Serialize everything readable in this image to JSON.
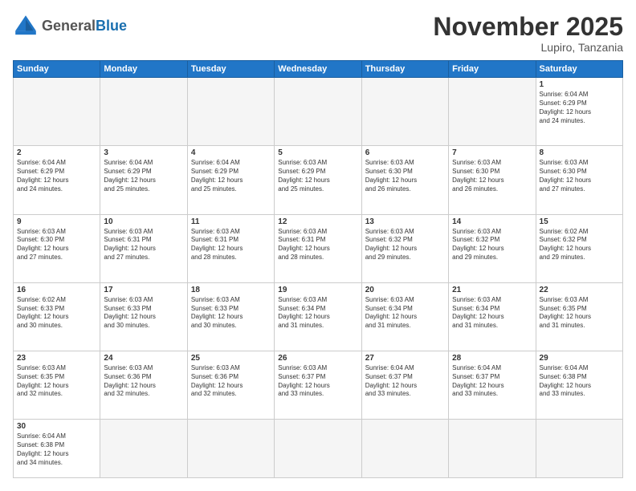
{
  "header": {
    "logo_general": "General",
    "logo_blue": "Blue",
    "month_title": "November 2025",
    "location": "Lupiro, Tanzania"
  },
  "weekdays": [
    "Sunday",
    "Monday",
    "Tuesday",
    "Wednesday",
    "Thursday",
    "Friday",
    "Saturday"
  ],
  "weeks": [
    [
      {
        "day": "",
        "info": "",
        "empty": true
      },
      {
        "day": "",
        "info": "",
        "empty": true
      },
      {
        "day": "",
        "info": "",
        "empty": true
      },
      {
        "day": "",
        "info": "",
        "empty": true
      },
      {
        "day": "",
        "info": "",
        "empty": true
      },
      {
        "day": "",
        "info": "",
        "empty": true
      },
      {
        "day": "1",
        "info": "Sunrise: 6:04 AM\nSunset: 6:29 PM\nDaylight: 12 hours\nand 24 minutes."
      }
    ],
    [
      {
        "day": "2",
        "info": "Sunrise: 6:04 AM\nSunset: 6:29 PM\nDaylight: 12 hours\nand 24 minutes."
      },
      {
        "day": "3",
        "info": "Sunrise: 6:04 AM\nSunset: 6:29 PM\nDaylight: 12 hours\nand 25 minutes."
      },
      {
        "day": "4",
        "info": "Sunrise: 6:04 AM\nSunset: 6:29 PM\nDaylight: 12 hours\nand 25 minutes."
      },
      {
        "day": "5",
        "info": "Sunrise: 6:03 AM\nSunset: 6:29 PM\nDaylight: 12 hours\nand 25 minutes."
      },
      {
        "day": "6",
        "info": "Sunrise: 6:03 AM\nSunset: 6:30 PM\nDaylight: 12 hours\nand 26 minutes."
      },
      {
        "day": "7",
        "info": "Sunrise: 6:03 AM\nSunset: 6:30 PM\nDaylight: 12 hours\nand 26 minutes."
      },
      {
        "day": "8",
        "info": "Sunrise: 6:03 AM\nSunset: 6:30 PM\nDaylight: 12 hours\nand 27 minutes."
      }
    ],
    [
      {
        "day": "9",
        "info": "Sunrise: 6:03 AM\nSunset: 6:30 PM\nDaylight: 12 hours\nand 27 minutes."
      },
      {
        "day": "10",
        "info": "Sunrise: 6:03 AM\nSunset: 6:31 PM\nDaylight: 12 hours\nand 27 minutes."
      },
      {
        "day": "11",
        "info": "Sunrise: 6:03 AM\nSunset: 6:31 PM\nDaylight: 12 hours\nand 28 minutes."
      },
      {
        "day": "12",
        "info": "Sunrise: 6:03 AM\nSunset: 6:31 PM\nDaylight: 12 hours\nand 28 minutes."
      },
      {
        "day": "13",
        "info": "Sunrise: 6:03 AM\nSunset: 6:32 PM\nDaylight: 12 hours\nand 29 minutes."
      },
      {
        "day": "14",
        "info": "Sunrise: 6:03 AM\nSunset: 6:32 PM\nDaylight: 12 hours\nand 29 minutes."
      },
      {
        "day": "15",
        "info": "Sunrise: 6:02 AM\nSunset: 6:32 PM\nDaylight: 12 hours\nand 29 minutes."
      }
    ],
    [
      {
        "day": "16",
        "info": "Sunrise: 6:02 AM\nSunset: 6:33 PM\nDaylight: 12 hours\nand 30 minutes."
      },
      {
        "day": "17",
        "info": "Sunrise: 6:03 AM\nSunset: 6:33 PM\nDaylight: 12 hours\nand 30 minutes."
      },
      {
        "day": "18",
        "info": "Sunrise: 6:03 AM\nSunset: 6:33 PM\nDaylight: 12 hours\nand 30 minutes."
      },
      {
        "day": "19",
        "info": "Sunrise: 6:03 AM\nSunset: 6:34 PM\nDaylight: 12 hours\nand 31 minutes."
      },
      {
        "day": "20",
        "info": "Sunrise: 6:03 AM\nSunset: 6:34 PM\nDaylight: 12 hours\nand 31 minutes."
      },
      {
        "day": "21",
        "info": "Sunrise: 6:03 AM\nSunset: 6:34 PM\nDaylight: 12 hours\nand 31 minutes."
      },
      {
        "day": "22",
        "info": "Sunrise: 6:03 AM\nSunset: 6:35 PM\nDaylight: 12 hours\nand 31 minutes."
      }
    ],
    [
      {
        "day": "23",
        "info": "Sunrise: 6:03 AM\nSunset: 6:35 PM\nDaylight: 12 hours\nand 32 minutes."
      },
      {
        "day": "24",
        "info": "Sunrise: 6:03 AM\nSunset: 6:36 PM\nDaylight: 12 hours\nand 32 minutes."
      },
      {
        "day": "25",
        "info": "Sunrise: 6:03 AM\nSunset: 6:36 PM\nDaylight: 12 hours\nand 32 minutes."
      },
      {
        "day": "26",
        "info": "Sunrise: 6:03 AM\nSunset: 6:37 PM\nDaylight: 12 hours\nand 33 minutes."
      },
      {
        "day": "27",
        "info": "Sunrise: 6:04 AM\nSunset: 6:37 PM\nDaylight: 12 hours\nand 33 minutes."
      },
      {
        "day": "28",
        "info": "Sunrise: 6:04 AM\nSunset: 6:37 PM\nDaylight: 12 hours\nand 33 minutes."
      },
      {
        "day": "29",
        "info": "Sunrise: 6:04 AM\nSunset: 6:38 PM\nDaylight: 12 hours\nand 33 minutes."
      }
    ],
    [
      {
        "day": "30",
        "info": "Sunrise: 6:04 AM\nSunset: 6:38 PM\nDaylight: 12 hours\nand 34 minutes."
      },
      {
        "day": "",
        "info": "",
        "empty": true
      },
      {
        "day": "",
        "info": "",
        "empty": true
      },
      {
        "day": "",
        "info": "",
        "empty": true
      },
      {
        "day": "",
        "info": "",
        "empty": true
      },
      {
        "day": "",
        "info": "",
        "empty": true
      },
      {
        "day": "",
        "info": "",
        "empty": true
      }
    ]
  ]
}
